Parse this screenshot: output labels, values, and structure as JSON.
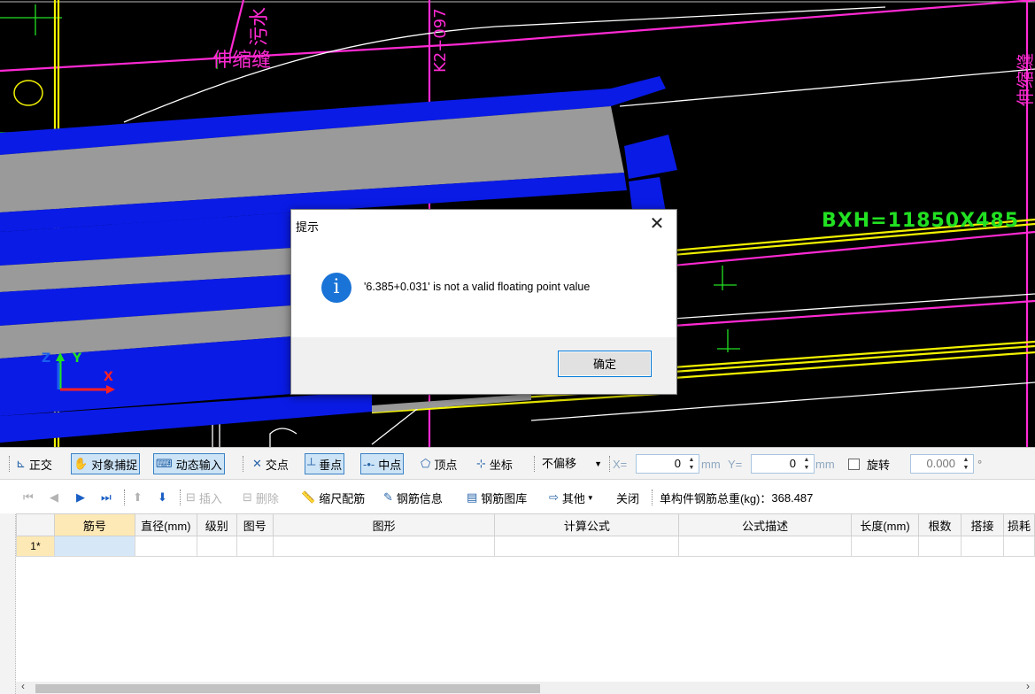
{
  "canvas": {
    "labels": {
      "expansion_joint_1": "伸缩缝",
      "expansion_joint_2": "伸缩缝",
      "sewage_pipe": "污水",
      "station": "K2+097",
      "bxh": "BXH=11850X485"
    },
    "axis": {
      "z": "Z",
      "y": "Y",
      "x": "X"
    },
    "colors": {
      "background": "#000000",
      "beam_blue": "#0a1be6",
      "beam_gray": "#9a9a9a",
      "magenta": "#ff2ad4",
      "yellow": "#f2f200",
      "green": "#22e022",
      "white": "#ffffff"
    }
  },
  "dialog": {
    "title": "提示",
    "message": "'6.385+0.031' is not a valid floating point value",
    "ok_label": "确定",
    "close_glyph": "✕",
    "icon": "info-icon"
  },
  "snap_toolbar": {
    "ortho": "正交",
    "object_snap": "对象捕捉",
    "dynamic_input": "动态输入",
    "intersection": "交点",
    "perpendicular": "垂点",
    "midpoint": "中点",
    "vertex": "顶点",
    "coordinate": "坐标",
    "offset_mode": "不偏移",
    "x_label": "X=",
    "x_value": "0",
    "x_unit": "mm",
    "y_label": "Y=",
    "y_value": "0",
    "y_unit": "mm",
    "rotate_label": "旋转",
    "rotate_value": "0.000",
    "rotate_unit": "°"
  },
  "rebar_toolbar": {
    "insert": "插入",
    "delete": "删除",
    "scale_rebar": "缩尺配筋",
    "rebar_info": "钢筋信息",
    "rebar_library": "钢筋图库",
    "other": "其他",
    "close": "关闭",
    "total_weight_label": "单构件钢筋总重(kg)：",
    "total_weight_value": "368.487"
  },
  "grid": {
    "columns": [
      "筋号",
      "直径(mm)",
      "级别",
      "图号",
      "图形",
      "计算公式",
      "公式描述",
      "长度(mm)",
      "根数",
      "搭接",
      "损耗"
    ],
    "rows": [
      {
        "index": "1*",
        "cells": [
          "",
          "",
          "",
          "",
          "",
          "",
          "",
          "",
          "",
          "",
          ""
        ]
      }
    ]
  }
}
